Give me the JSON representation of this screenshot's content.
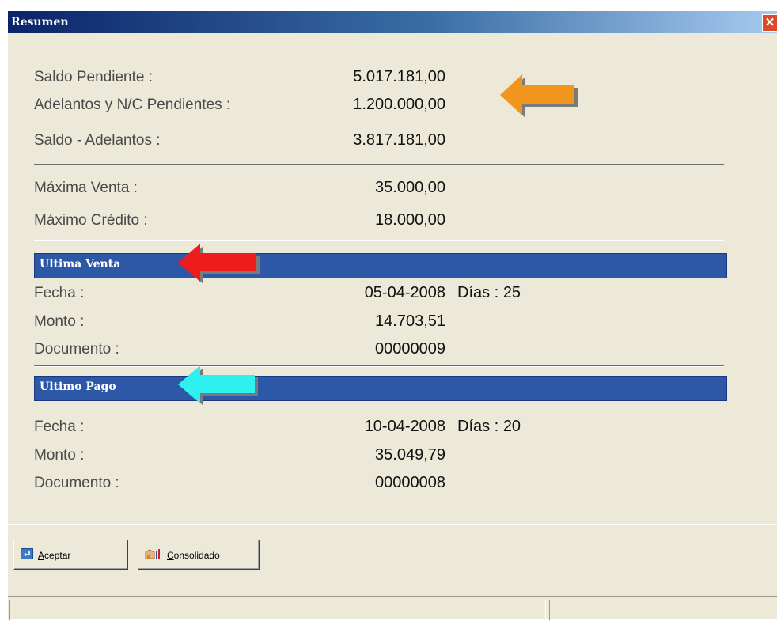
{
  "window": {
    "title": "Resumen",
    "close_glyph": "✕"
  },
  "summary": {
    "saldo_pendiente": {
      "label": "Saldo Pendiente :",
      "value": "5.017.181,00"
    },
    "adelantos": {
      "label": "Adelantos y N/C Pendientes :",
      "value": "1.200.000,00"
    },
    "saldo_adelantos": {
      "label": "Saldo - Adelantos :",
      "value": "3.817.181,00"
    },
    "maxima_venta": {
      "label": "Máxima Venta :",
      "value": "35.000,00"
    },
    "maximo_credito": {
      "label": "Máximo Crédito :",
      "value": "18.000,00"
    }
  },
  "ultima_venta": {
    "header": "Ultima Venta",
    "fecha_label": "Fecha :",
    "fecha_value": "05-04-2008",
    "dias_label": "Días :",
    "dias_value": "25",
    "monto_label": "Monto :",
    "monto_value": "14.703,51",
    "documento_label": "Documento :",
    "documento_value": "00000009"
  },
  "ultimo_pago": {
    "header": "Ultimo Pago",
    "fecha_label": "Fecha :",
    "fecha_value": "10-04-2008",
    "dias_label": "Días :",
    "dias_value": "20",
    "monto_label": "Monto :",
    "monto_value": "35.049,79",
    "documento_label": "Documento :",
    "documento_value": "00000008"
  },
  "buttons": {
    "aceptar": {
      "first": "A",
      "rest": "ceptar",
      "icon": "enter-icon"
    },
    "consolidado": {
      "first": "C",
      "rest": "onsolidado",
      "icon": "consolidate-icon"
    }
  },
  "annotations": {
    "arrow_colors": {
      "orange": "#f0961e",
      "red": "#ee1c1c",
      "cyan": "#2ef0f0"
    }
  },
  "colors": {
    "band": "#2d58a8",
    "dialog_bg": "#ece9d8",
    "titlebar": "#0a246a"
  }
}
